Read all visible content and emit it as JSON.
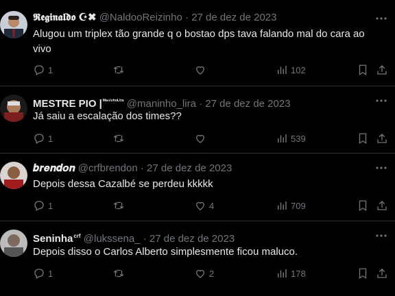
{
  "tweets": [
    {
      "name": "𝕽𝖊𝖌𝖎𝖓𝖆𝖑𝖉𝖔 ☪︎✖",
      "name_sup": "",
      "handle": "@NaldooReizinho",
      "date": "27 de dez de 2023",
      "text": "Alugou um triplex tão grande q o bostao dps tava falando mal do cara ao vivo",
      "replies": "1",
      "retweets": "",
      "likes": "",
      "views": "102",
      "avatar_color": "#5b6f8a"
    },
    {
      "name": "MESTRE PIO |",
      "name_sup": "ᴹᵃⁿⁱⁿʰᵒᴸⁱʳᵃ",
      "handle": "@maninho_lira",
      "date": "27 de dez de 2023",
      "text": "Já saiu a escalação dos times??",
      "replies": "1",
      "retweets": "",
      "likes": "",
      "views": "539",
      "avatar_color": "#7a2b2b"
    },
    {
      "name": "𝒃𝒓𝒆𝒏𝒅𝒐𝒏",
      "name_sup": "",
      "handle": "@crfbrendon",
      "date": "27 de dez de 2023",
      "text": "Depois dessa Cazalbé se perdeu kkkkk",
      "replies": "1",
      "retweets": "",
      "likes": "4",
      "views": "709",
      "avatar_color": "#8a3f3a"
    },
    {
      "name": "Seninha",
      "name_sup": "crf",
      "handle": "@lukssena_",
      "date": "27 de dez de 2023",
      "text": "Depois disso o Carlos Alberto simplesmente ficou maluco.",
      "replies": "1",
      "retweets": "",
      "likes": "2",
      "views": "178",
      "avatar_color": "#8d8d8d"
    }
  ],
  "separator": "·",
  "icons": [
    "reply-icon",
    "retweet-icon",
    "like-icon",
    "views-icon",
    "bookmark-icon",
    "share-icon",
    "more-icon"
  ]
}
